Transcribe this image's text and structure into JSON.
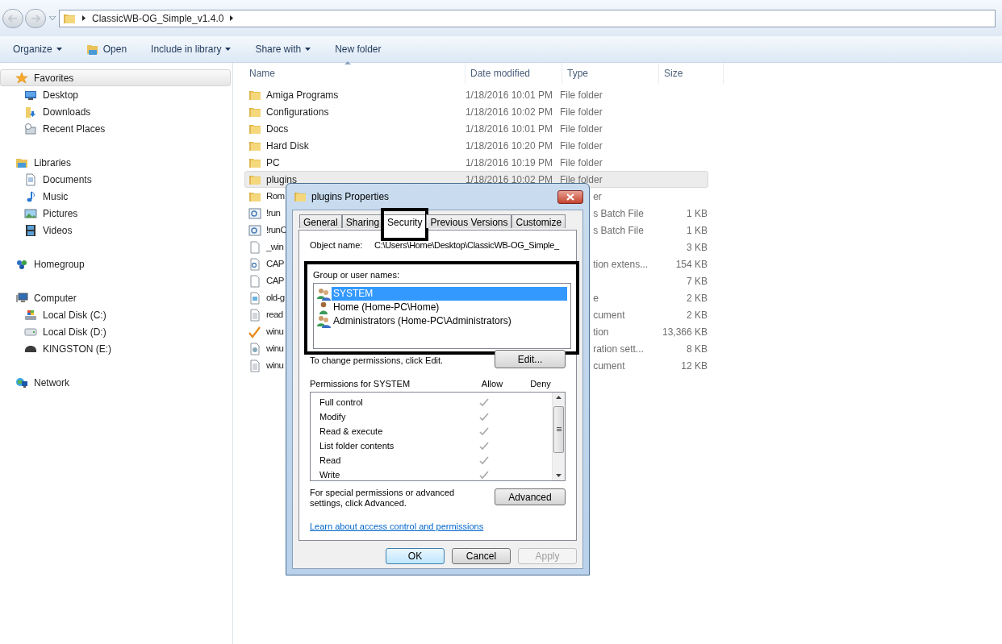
{
  "address_bar": {
    "path": [
      "ClassicWB-OG_Simple_v1.4.0"
    ]
  },
  "toolbar": [
    {
      "label": "Organize",
      "kind": "text",
      "dropdown": true
    },
    {
      "label": "Open",
      "kind": "icon",
      "dropdown": false
    },
    {
      "label": "Include in library",
      "kind": "text",
      "dropdown": true
    },
    {
      "label": "Share with",
      "kind": "text",
      "dropdown": true
    },
    {
      "label": "New folder",
      "kind": "text",
      "dropdown": false
    }
  ],
  "sidebar": [
    {
      "label": "Favorites",
      "kind": "star",
      "selected": true,
      "children": [
        {
          "label": "Desktop",
          "kind": "desktop",
          "selected": false
        },
        {
          "label": "Downloads",
          "kind": "downloads",
          "selected": false
        },
        {
          "label": "Recent Places",
          "kind": "recent",
          "selected": false
        }
      ]
    },
    {
      "label": "Libraries",
      "kind": "library",
      "selected": false,
      "children": [
        {
          "label": "Documents",
          "kind": "document",
          "selected": false
        },
        {
          "label": "Music",
          "kind": "music",
          "selected": false
        },
        {
          "label": "Pictures",
          "kind": "pictures",
          "selected": false
        },
        {
          "label": "Videos",
          "kind": "videos",
          "selected": false
        }
      ]
    },
    {
      "label": "Homegroup",
      "kind": "homegroup",
      "selected": false
    },
    {
      "label": "Computer",
      "kind": "computer",
      "selected": false,
      "children": [
        {
          "label": "Local Disk (C:)",
          "kind": "systemdisk",
          "selected": false
        },
        {
          "label": "Local Disk (D:)",
          "kind": "disk",
          "selected": false
        },
        {
          "label": "KINGSTON (E:)",
          "kind": "usb",
          "selected": false
        }
      ]
    },
    {
      "label": "Network",
      "kind": "network",
      "selected": false
    }
  ],
  "file_list": {
    "columns": [
      "Name",
      "Date modified",
      "Type",
      "Size"
    ],
    "rows": [
      {
        "kind": "folder",
        "name": "Amiga Programs",
        "date": "1/18/2016 10:01 PM",
        "type": "File folder",
        "selected": false,
        "covered": false
      },
      {
        "kind": "folder",
        "name": "Configurations",
        "date": "1/18/2016 10:02 PM",
        "type": "File folder",
        "selected": false,
        "covered": false
      },
      {
        "kind": "folder",
        "name": "Docs",
        "date": "1/18/2016 10:01 PM",
        "type": "File folder",
        "selected": false,
        "covered": false
      },
      {
        "kind": "folder",
        "name": "Hard Disk",
        "date": "1/18/2016 10:20 PM",
        "type": "File folder",
        "selected": false,
        "covered": false
      },
      {
        "kind": "folder",
        "name": "PC",
        "date": "1/18/2016 10:19 PM",
        "type": "File folder",
        "selected": false,
        "covered": false
      },
      {
        "kind": "folder",
        "name": "plugins",
        "date": "1/18/2016 10:02 PM",
        "type": "File folder",
        "selected": true,
        "covered": false
      },
      {
        "kind": "folder",
        "name": "Rom",
        "type": "er",
        "selected": false,
        "covered": true
      },
      {
        "kind": "batch",
        "name": "!run",
        "type": "s Batch File",
        "size": "1 KB",
        "selected": false,
        "covered": true
      },
      {
        "kind": "batch",
        "name": "!runC",
        "type": "s Batch File",
        "size": "1 KB",
        "selected": false,
        "covered": true
      },
      {
        "kind": "file",
        "name": "_win",
        "size": "3 KB",
        "selected": false,
        "covered": true
      },
      {
        "kind": "extension",
        "name": "CAP",
        "type": "tion extens...",
        "size": "154 KB",
        "selected": false,
        "covered": true
      },
      {
        "kind": "file",
        "name": "CAP",
        "size": "7 KB",
        "selected": false,
        "covered": true
      },
      {
        "kind": "image",
        "name": "old-g",
        "type": "e",
        "size": "2 KB",
        "selected": false,
        "covered": true
      },
      {
        "kind": "text",
        "name": "read",
        "type": "cument",
        "size": "2 KB",
        "selected": false,
        "covered": true
      },
      {
        "kind": "setup",
        "name": "winu",
        "type": "tion",
        "size": "13,366 KB",
        "selected": false,
        "covered": true
      },
      {
        "kind": "settings",
        "name": "winu",
        "type": "ration sett...",
        "size": "8 KB",
        "selected": false,
        "covered": true
      },
      {
        "kind": "text",
        "name": "winu",
        "type": "cument",
        "size": "12 KB",
        "selected": false,
        "covered": true
      }
    ]
  },
  "dialog": {
    "title": "plugins Properties",
    "tabs": [
      {
        "label": "General",
        "selected": false,
        "framed": false
      },
      {
        "label": "Sharing",
        "selected": false,
        "framed": false
      },
      {
        "label": "Security",
        "selected": true,
        "framed": true
      },
      {
        "label": "Previous Versions",
        "selected": false,
        "framed": false
      },
      {
        "label": "Customize",
        "selected": false,
        "framed": false
      }
    ],
    "object_name_label": "Object name:",
    "object_name": "C:\\Users\\Home\\Desktop\\ClassicWB-OG_Simple_",
    "group_label": "Group or user names:",
    "group_framed": true,
    "groups": [
      {
        "name": "SYSTEM",
        "kind": "group",
        "selected": true
      },
      {
        "name": "Home (Home-PC\\Home)",
        "kind": "user",
        "selected": false
      },
      {
        "name": "Administrators (Home-PC\\Administrators)",
        "kind": "group",
        "selected": false
      }
    ],
    "edit_hint": "To change permissions, click Edit.",
    "edit_button": "Edit...",
    "permissions_label": "Permissions for SYSTEM",
    "allow_header": "Allow",
    "deny_header": "Deny",
    "permissions": [
      {
        "name": "Full control",
        "allow": true,
        "deny": false
      },
      {
        "name": "Modify",
        "allow": true,
        "deny": false
      },
      {
        "name": "Read & execute",
        "allow": true,
        "deny": false
      },
      {
        "name": "List folder contents",
        "allow": true,
        "deny": false
      },
      {
        "name": "Read",
        "allow": true,
        "deny": false
      },
      {
        "name": "Write",
        "allow": true,
        "deny": false
      }
    ],
    "advanced_hint": "For special permissions or advanced settings, click Advanced.",
    "advanced_button": "Advanced",
    "link": "Learn about access control and permissions",
    "buttons": [
      {
        "label": "OK",
        "default": true,
        "disabled": false
      },
      {
        "label": "Cancel",
        "default": false,
        "disabled": false
      },
      {
        "label": "Apply",
        "default": false,
        "disabled": true
      }
    ]
  }
}
